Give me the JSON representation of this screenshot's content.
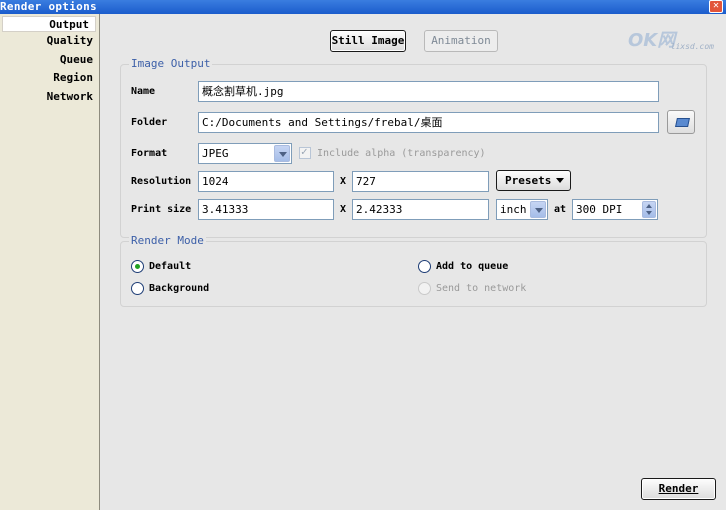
{
  "window": {
    "title": "Render options"
  },
  "watermark": {
    "logo": "OK网",
    "url": "lixsd.com"
  },
  "sidebar": {
    "items": [
      {
        "label": "Output"
      },
      {
        "label": "Quality"
      },
      {
        "label": "Queue"
      },
      {
        "label": "Region"
      },
      {
        "label": "Network"
      }
    ]
  },
  "tabs": {
    "still": "Still Image",
    "animation": "Animation"
  },
  "image_output": {
    "title": "Image Output",
    "name_label": "Name",
    "name_value": "概念割草机.jpg",
    "folder_label": "Folder",
    "folder_value": "C:/Documents and Settings/frebal/桌面",
    "format_label": "Format",
    "format_value": "JPEG",
    "alpha_label": "Include alpha (transparency)",
    "resolution_label": "Resolution",
    "res_width": "1024",
    "res_x": "X",
    "res_height": "727",
    "presets_label": "Presets",
    "print_label": "Print size",
    "print_width": "3.41333",
    "print_x": "X",
    "print_height": "2.42333",
    "unit_value": "inch",
    "at_label": "at",
    "dpi_value": "300 DPI"
  },
  "render_mode": {
    "title": "Render Mode",
    "default_label": "Default",
    "background_label": "Background",
    "queue_label": "Add to queue",
    "network_label": "Send to network"
  },
  "render_button": "Render"
}
